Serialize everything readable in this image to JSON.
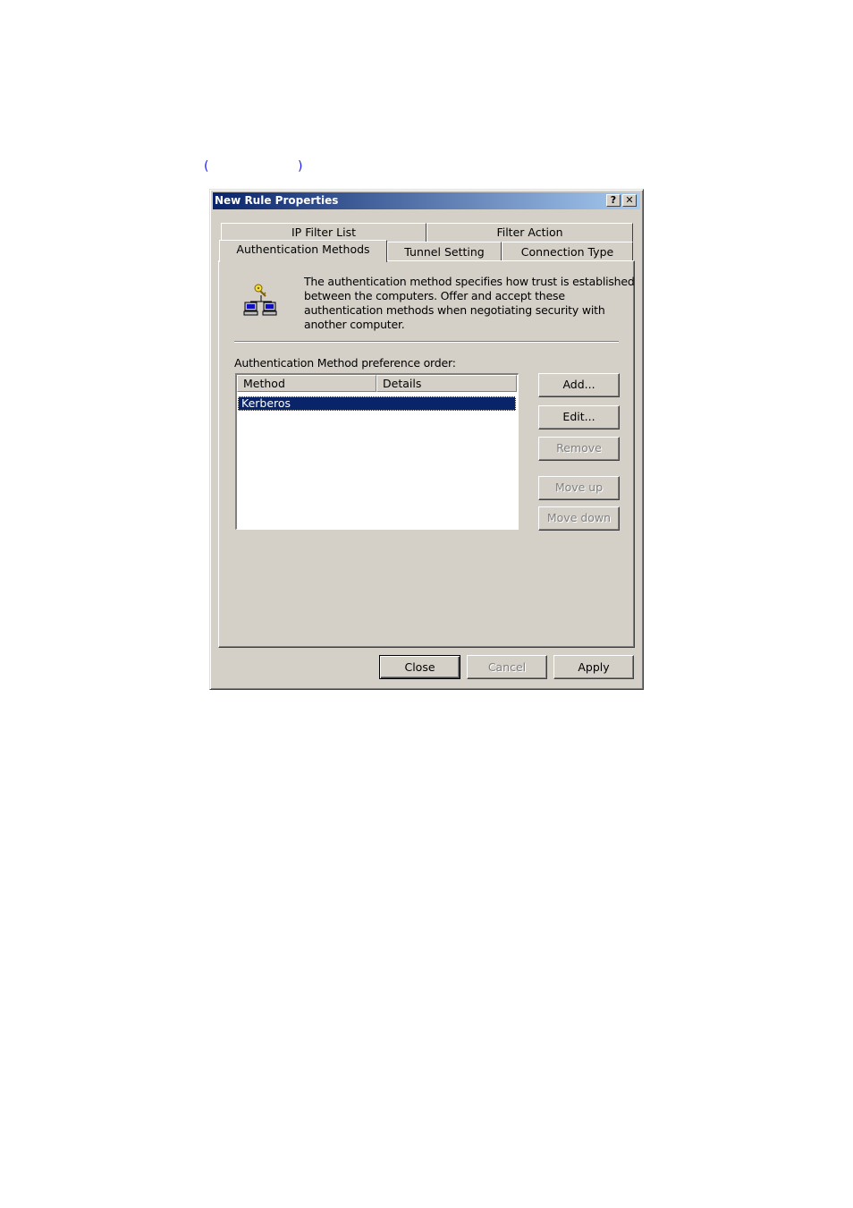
{
  "caption": {
    "open": "(",
    "close": ")"
  },
  "window": {
    "title": "New Rule Properties",
    "help_button": "?",
    "close_button": "✕"
  },
  "tabs": {
    "row_back": [
      {
        "label": "IP Filter List"
      },
      {
        "label": "Filter Action"
      }
    ],
    "row_front": [
      {
        "label": "Authentication Methods",
        "active": true
      },
      {
        "label": "Tunnel Setting"
      },
      {
        "label": "Connection Type"
      }
    ]
  },
  "panel": {
    "icon": "key-computers-icon",
    "description": [
      "The authentication method specifies how trust is established",
      "between the computers. Offer and accept these",
      "authentication methods when negotiating security with",
      "another computer."
    ],
    "list_label": "Authentication Method preference order:",
    "columns": [
      "Method",
      "Details"
    ],
    "rows": [
      {
        "method": "Kerberos",
        "details": "",
        "selected": true
      }
    ],
    "buttons": {
      "add": "Add...",
      "edit": "Edit...",
      "remove": "Remove",
      "move_up": "Move up",
      "move_down": "Move down"
    }
  },
  "footer": {
    "close": "Close",
    "cancel": "Cancel",
    "apply": "Apply"
  },
  "colors": {
    "face": "#d4d0c8",
    "title_start": "#0a246a",
    "title_end": "#a6caf0",
    "selection": "#0a246a",
    "caption_paren": "#1a1aff"
  }
}
